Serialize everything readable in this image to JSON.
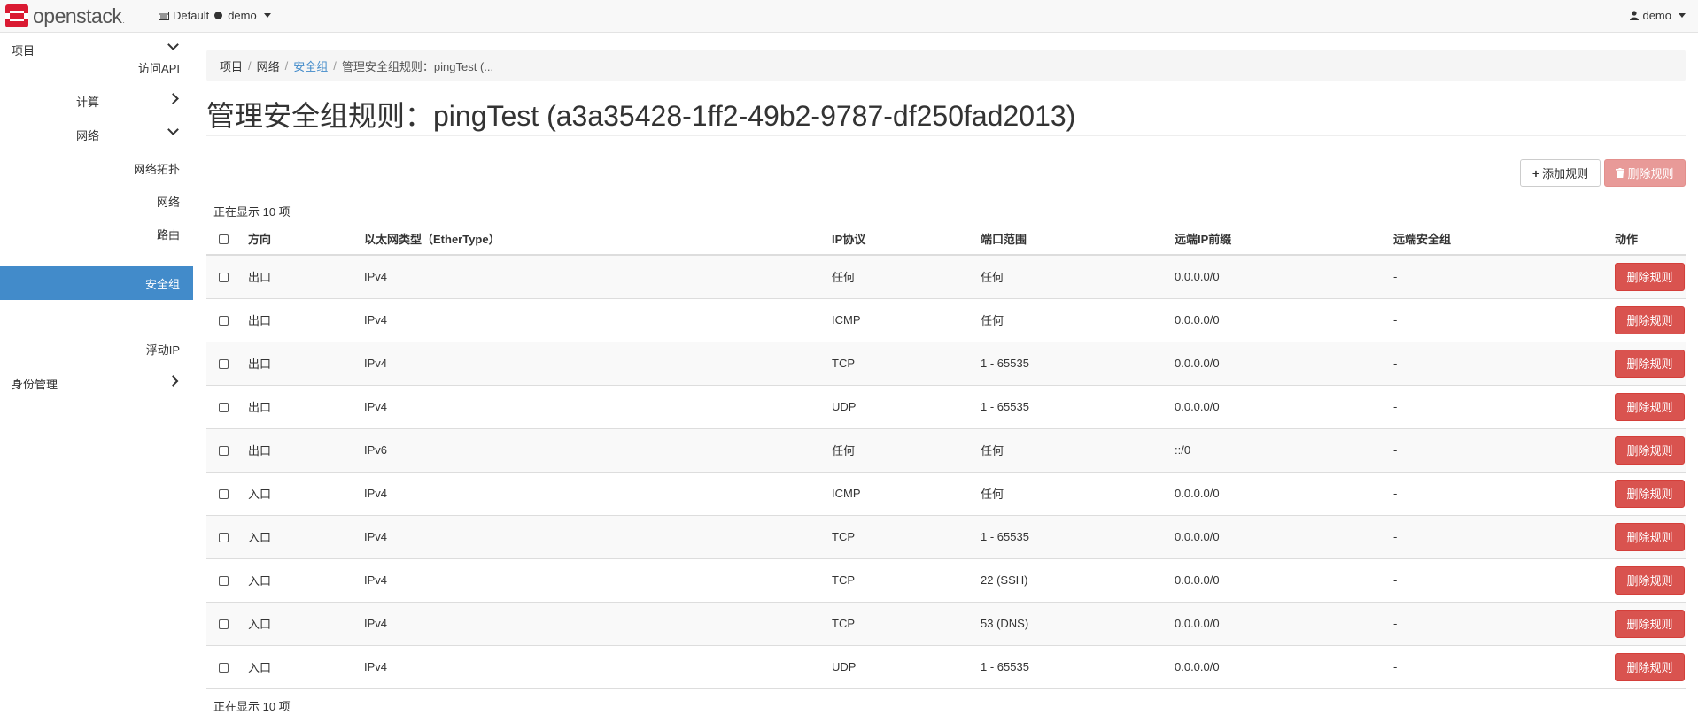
{
  "brand": {
    "name": "openstack",
    "suffix": "."
  },
  "topbar": {
    "domain": "Default",
    "project": "demo",
    "user": "demo"
  },
  "sidebar": {
    "project": "项目",
    "access_api": "访问API",
    "compute": "计算",
    "network": "网络",
    "network_topology": "网络拓扑",
    "networks": "网络",
    "routers": "路由",
    "security_groups": "安全组",
    "floating_ips": "浮动IP",
    "identity": "身份管理"
  },
  "breadcrumb": {
    "item1": "项目",
    "item2": "网络",
    "item3": "安全组",
    "item4": "管理安全组规则：pingTest (..."
  },
  "page_title": "管理安全组规则：pingTest (a3a35428-1ff2-49b2-9787-df250fad2013)",
  "actions": {
    "add_rule": "添加规则",
    "delete_rules": "删除规则"
  },
  "count_top": "正在显示 10 项",
  "count_bottom": "正在显示 10 项",
  "table": {
    "headers": {
      "direction": "方向",
      "ethertype": "以太网类型（EtherType）",
      "protocol": "IP协议",
      "port_range": "端口范围",
      "remote_ip": "远端IP前缀",
      "remote_group": "远端安全组",
      "actions": "动作"
    },
    "rows": [
      {
        "direction": "出口",
        "ethertype": "IPv4",
        "protocol": "任何",
        "port_range": "任何",
        "remote_ip": "0.0.0.0/0",
        "remote_group": "-",
        "action": "删除规则"
      },
      {
        "direction": "出口",
        "ethertype": "IPv4",
        "protocol": "ICMP",
        "port_range": "任何",
        "remote_ip": "0.0.0.0/0",
        "remote_group": "-",
        "action": "删除规则"
      },
      {
        "direction": "出口",
        "ethertype": "IPv4",
        "protocol": "TCP",
        "port_range": "1 - 65535",
        "remote_ip": "0.0.0.0/0",
        "remote_group": "-",
        "action": "删除规则"
      },
      {
        "direction": "出口",
        "ethertype": "IPv4",
        "protocol": "UDP",
        "port_range": "1 - 65535",
        "remote_ip": "0.0.0.0/0",
        "remote_group": "-",
        "action": "删除规则"
      },
      {
        "direction": "出口",
        "ethertype": "IPv6",
        "protocol": "任何",
        "port_range": "任何",
        "remote_ip": "::/0",
        "remote_group": "-",
        "action": "删除规则"
      },
      {
        "direction": "入口",
        "ethertype": "IPv4",
        "protocol": "ICMP",
        "port_range": "任何",
        "remote_ip": "0.0.0.0/0",
        "remote_group": "-",
        "action": "删除规则"
      },
      {
        "direction": "入口",
        "ethertype": "IPv4",
        "protocol": "TCP",
        "port_range": "1 - 65535",
        "remote_ip": "0.0.0.0/0",
        "remote_group": "-",
        "action": "删除规则"
      },
      {
        "direction": "入口",
        "ethertype": "IPv4",
        "protocol": "TCP",
        "port_range": "22 (SSH)",
        "remote_ip": "0.0.0.0/0",
        "remote_group": "-",
        "action": "删除规则"
      },
      {
        "direction": "入口",
        "ethertype": "IPv4",
        "protocol": "TCP",
        "port_range": "53 (DNS)",
        "remote_ip": "0.0.0.0/0",
        "remote_group": "-",
        "action": "删除规则"
      },
      {
        "direction": "入口",
        "ethertype": "IPv4",
        "protocol": "UDP",
        "port_range": "1 - 65535",
        "remote_ip": "0.0.0.0/0",
        "remote_group": "-",
        "action": "删除规则"
      }
    ]
  }
}
